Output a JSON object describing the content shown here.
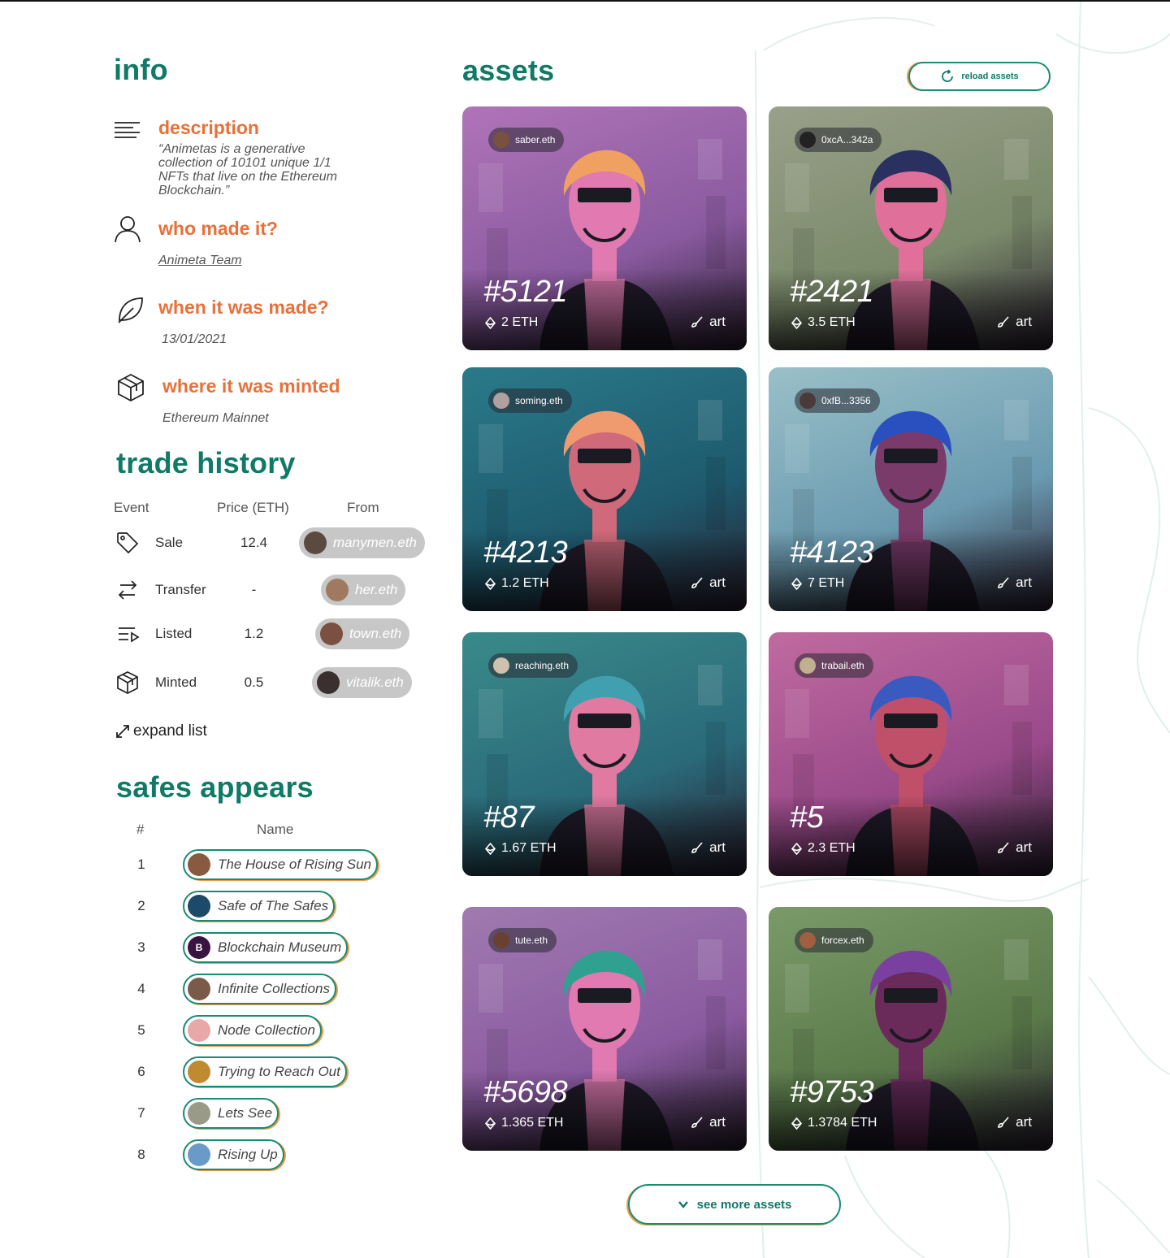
{
  "info": {
    "heading": "info",
    "description": {
      "title": "description",
      "text": "“Animetas is a generative collection of 10101 unique 1/1 NFTs that live on the Ethereum Blockchain.”"
    },
    "creator": {
      "title": "who made it?",
      "value": "Animeta Team"
    },
    "made": {
      "title": "when it was made?",
      "value": "13/01/2021"
    },
    "minted": {
      "title": "where it was minted",
      "value": "Ethereum Mainnet"
    }
  },
  "trade_history": {
    "heading": "trade history",
    "columns": [
      "Event",
      "Price (ETH)",
      "From"
    ],
    "rows": [
      {
        "event": "Sale",
        "icon": "tag-icon",
        "price": "12.4",
        "from": "manymen.eth",
        "avatar_color": "#5a4a40"
      },
      {
        "event": "Transfer",
        "icon": "transfer-icon",
        "price": "-",
        "from": "her.eth",
        "avatar_color": "#a07a60"
      },
      {
        "event": "Listed",
        "icon": "list-icon",
        "price": "1.2",
        "from": "town.eth",
        "avatar_color": "#7a5040"
      },
      {
        "event": "Minted",
        "icon": "cube-icon",
        "price": "0.5",
        "from": "vitalik.eth",
        "avatar_color": "#3a3030"
      }
    ],
    "expand_label": "expand list"
  },
  "safes": {
    "heading": "safes appears",
    "columns": [
      "#",
      "Name"
    ],
    "rows": [
      {
        "num": "1",
        "name": "The House of Rising Sun",
        "avatar_color": "#8a5a40"
      },
      {
        "num": "2",
        "name": "Safe of The Safes",
        "avatar_color": "#1b4a6a"
      },
      {
        "num": "3",
        "name": "Blockchain Museum",
        "avatar_color": "#3a1440",
        "avatar_glyph": "B"
      },
      {
        "num": "4",
        "name": "Infinite Collections",
        "avatar_color": "#7a5a48"
      },
      {
        "num": "5",
        "name": "Node Collection",
        "avatar_color": "#e8a8a8"
      },
      {
        "num": "6",
        "name": "Trying to Reach Out",
        "avatar_color": "#c08a30"
      },
      {
        "num": "7",
        "name": "Lets See",
        "avatar_color": "#9a9a88"
      },
      {
        "num": "8",
        "name": "Rising Up",
        "avatar_color": "#6a9ac8"
      }
    ]
  },
  "assets": {
    "heading": "assets",
    "reload_label": "reload assets",
    "see_more_label": "see more assets",
    "cards": [
      {
        "owner": "saber.eth",
        "token": "#5121",
        "price": "2 ETH",
        "category": "art",
        "bg": "#8a5aa0",
        "bg2": "#b074b8",
        "hair": "#f0a060",
        "skin": "#e07ab0",
        "owner_av": "#7a5040"
      },
      {
        "owner": "0xcA...342a",
        "token": "#2421",
        "price": "3.5 ETH",
        "category": "art",
        "bg": "#7a8a6a",
        "bg2": "#9aa08a",
        "hair": "#2a3060",
        "skin": "#e0709a",
        "owner_av": "#222222"
      },
      {
        "owner": "soming.eth",
        "token": "#4213",
        "price": "1.2 ETH",
        "category": "art",
        "bg": "#1e5a6e",
        "bg2": "#2a7a8a",
        "hair": "#f09a70",
        "skin": "#d06a7a",
        "owner_av": "#b0a0a0"
      },
      {
        "owner": "0xfB...3356",
        "token": "#4123",
        "price": "7 ETH",
        "category": "art",
        "bg": "#6a9ab0",
        "bg2": "#9ac0c8",
        "hair": "#2a50c0",
        "skin": "#7a3a6a",
        "owner_av": "#4a3a3a"
      },
      {
        "owner": "reaching.eth",
        "token": "#87",
        "price": "1.67 ETH",
        "category": "art",
        "bg": "#2a6a7a",
        "bg2": "#3a8a8a",
        "hair": "#40a0b0",
        "skin": "#e07aa0",
        "owner_av": "#d0c0b0"
      },
      {
        "owner": "trabail.eth",
        "token": "#5",
        "price": "2.3 ETH",
        "category": "art",
        "bg": "#9a4a8a",
        "bg2": "#c06aa0",
        "hair": "#3a5ac0",
        "skin": "#c0506a",
        "owner_av": "#c0b090"
      },
      {
        "owner": "tute.eth",
        "token": "#5698",
        "price": "1.365 ETH",
        "category": "art",
        "bg": "#8a5aa0",
        "bg2": "#a07ab0",
        "hair": "#30a090",
        "skin": "#e07ab0",
        "owner_av": "#6a4030"
      },
      {
        "owner": "forcex.eth",
        "token": "#9753",
        "price": "1.3784 ETH",
        "category": "art",
        "bg": "#5a7a4a",
        "bg2": "#7a9a6a",
        "hair": "#7a40a0",
        "skin": "#6a2a5a",
        "owner_av": "#a06040"
      }
    ]
  }
}
